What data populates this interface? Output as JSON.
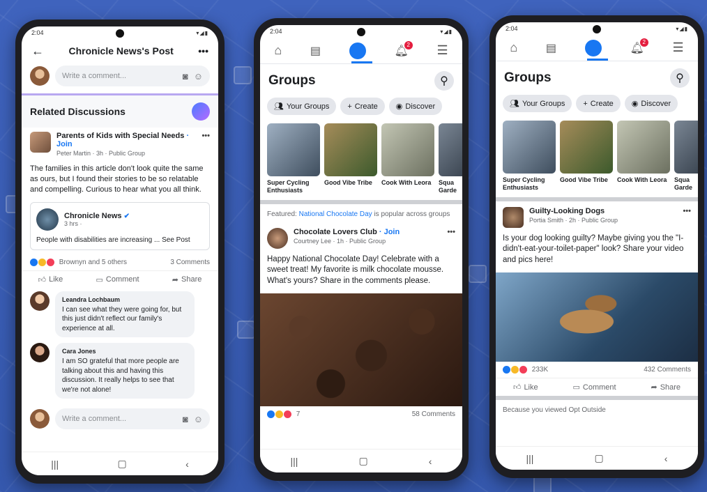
{
  "phone1": {
    "status_time": "2:04",
    "header_title": "Chronicle News's Post",
    "comment_placeholder": "Write a comment...",
    "related_heading": "Related Discussions",
    "group_post": {
      "group_name": "Parents of Kids with Special Needs",
      "join_label": "Join",
      "meta": "Peter Martin · 3h · Public Group",
      "text": "The families in this article don't look quite the same as ours, but I found their stories to be so relatable and compelling. Curious to hear what you all think."
    },
    "shared": {
      "source": "Chronicle News",
      "meta": "3 hrs ·",
      "text": "People with disabilities are increasing ... See Post"
    },
    "reactions_text": "Brownyn and 5 others",
    "comments_count": "3 Comments",
    "actions": {
      "like": "Like",
      "comment": "Comment",
      "share": "Share"
    },
    "comments": [
      {
        "author": "Leandra Lochbaum",
        "text": "I can see what they were going for, but this just didn't reflect our family's experience at all."
      },
      {
        "author": "Cara Jones",
        "text": "I am SO grateful that more people are talking about this and having this discussion. It really helps to see that we're not alone!"
      }
    ],
    "bottom_comment_placeholder": "Write a comment..."
  },
  "phone2": {
    "status_time": "2:04",
    "notif_badge": "2",
    "title": "Groups",
    "chips": [
      "Your Groups",
      "Create",
      "Discover"
    ],
    "tiles": [
      {
        "label": "Super Cycling Enthusiasts",
        "color": "#6b7d8e"
      },
      {
        "label": "Good Vibe Tribe",
        "color": "#7a6a45"
      },
      {
        "label": "Cook With Leora",
        "color": "#8a8f7a"
      },
      {
        "label": "Squa Garde",
        "color": "#556070"
      }
    ],
    "featured_prefix": "Featured:",
    "featured_link": "National Chocolate Day",
    "featured_suffix": "is popular across groups",
    "post": {
      "group_name": "Chocolate Lovers Club",
      "join_label": "Join",
      "meta": "Courtney Lee · 1h · Public Group",
      "text": "Happy National Chocolate Day! Celebrate with a sweet treat! My favorite is milk chocolate mousse. What's yours? Share in the comments please.",
      "reactions": "7",
      "comments": "58 Comments"
    }
  },
  "phone3": {
    "status_time": "2:04",
    "notif_badge": "2",
    "title": "Groups",
    "chips": [
      "Your Groups",
      "Create",
      "Discover"
    ],
    "tiles": [
      {
        "label": "Super Cycling Enthusiasts",
        "color": "#6b7d8e"
      },
      {
        "label": "Good Vibe Tribe",
        "color": "#7a6a45"
      },
      {
        "label": "Cook With Leora",
        "color": "#8a8f7a"
      },
      {
        "label": "Squa Garde",
        "color": "#556070"
      }
    ],
    "post": {
      "group_name": "Guilty-Looking Dogs",
      "meta": "Portia Smith · 2h · Public Group",
      "text": "Is your dog looking guilty? Maybe giving you the \"I-didn't-eat-your-toilet-paper\" look? Share your video and pics here!",
      "reactions": "233K",
      "comments": "432 Comments"
    },
    "actions": {
      "like": "Like",
      "comment": "Comment",
      "share": "Share"
    },
    "because_text": "Because you viewed Opt Outside"
  }
}
